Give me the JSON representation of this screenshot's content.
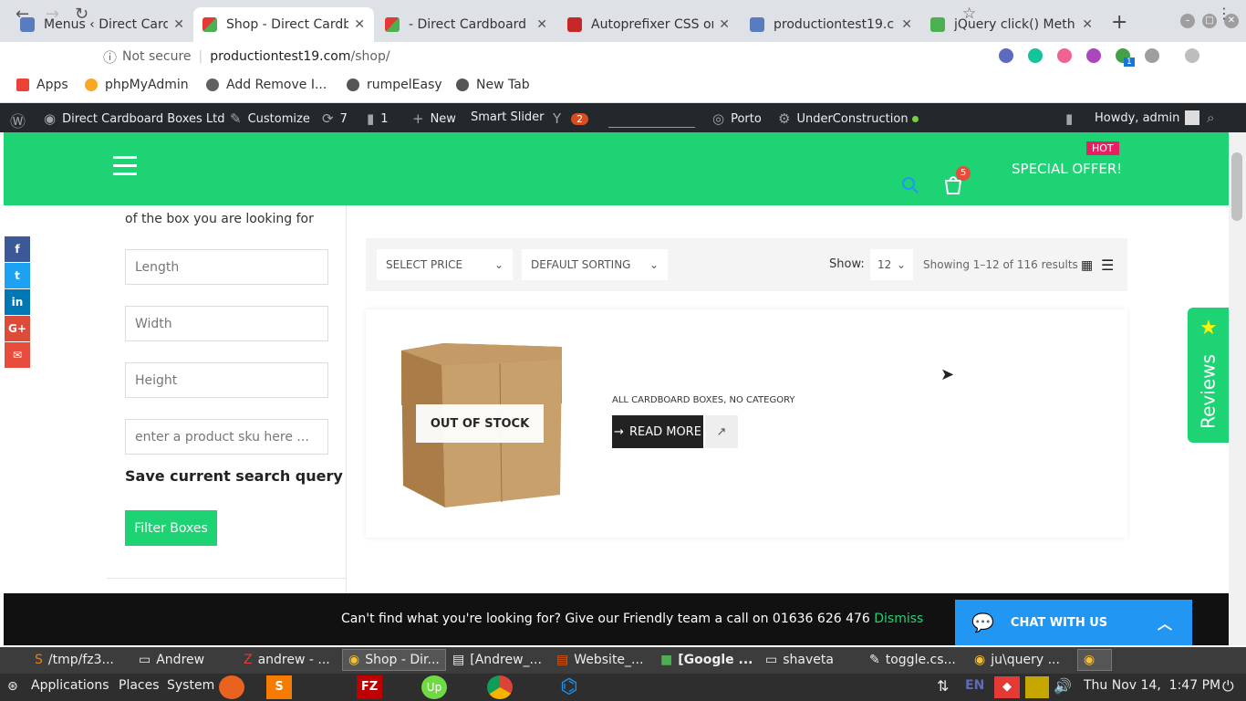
{
  "browser": {
    "tabs": [
      {
        "title": "Menus ‹ Direct Card",
        "icon": "wordpress-icon"
      },
      {
        "title": "Shop - Direct Cardbo",
        "icon": "cube-icon",
        "active": true
      },
      {
        "title": "- Direct Cardboard E",
        "icon": "cube-icon"
      },
      {
        "title": "Autoprefixer CSS on",
        "icon": "autoprefixer-icon"
      },
      {
        "title": "productiontest19.c",
        "icon": "wordpress-icon"
      },
      {
        "title": "jQuery click() Meth",
        "icon": "w3schools-icon"
      }
    ],
    "security": "Not secure",
    "url_host": "productiontest19.com",
    "url_path": "/shop/",
    "bookmarks": [
      "Apps",
      "phpMyAdmin",
      "Add Remove I...",
      "rumpelEasy",
      "New Tab"
    ],
    "ext_badge": "1"
  },
  "wp_admin_bar": {
    "site": "Direct Cardboard Boxes Ltd",
    "customize": "Customize",
    "updates": "7",
    "comments": "1",
    "new": "New",
    "smart_slider": "Smart Slider",
    "yoast_count": "2",
    "porto": "Porto",
    "under_construction": "UnderConstruction",
    "howdy": "Howdy, admin"
  },
  "header": {
    "hot": "HOT",
    "special_offer": "SPECIAL OFFER!",
    "cart_count": "5"
  },
  "sidebar": {
    "intro": "of the box you are looking for",
    "length_placeholder": "Length",
    "width_placeholder": "Width",
    "height_placeholder": "Height",
    "sku_placeholder": "enter a product sku here ...",
    "save_query": "Save current search query",
    "filter_button": "Filter Boxes"
  },
  "toolbar": {
    "select_price": "SELECT PRICE",
    "default_sorting": "DEFAULT SORTING",
    "show_label": "Show:",
    "show_value": "12",
    "results": "Showing 1–12 of 116 results"
  },
  "product": {
    "stock": "OUT OF STOCK",
    "categories": "ALL CARDBOARD BOXES, NO CATEGORY",
    "read_more": "READ MORE"
  },
  "reviews_tab": "Reviews",
  "notice": {
    "text": "Can't find what you're looking for? Give our Friendly team a call on 01636 626 476",
    "dismiss": "Dismiss"
  },
  "chat": "CHAT WITH US",
  "taskbar": {
    "windows": [
      "/tmp/fz3...",
      "Andrew",
      "andrew - ...",
      "Shop - Dir...",
      "[Andrew_...",
      "Website_...",
      "[Google ...",
      "shaveta",
      "toggle.cs...",
      "ju\\query ..."
    ],
    "menus": [
      "Applications",
      "Places",
      "System"
    ],
    "lang": "EN",
    "clock": "Thu Nov 14,  1:47 PM"
  },
  "colors": {
    "brand_green": "#1ed373",
    "chat_blue": "#2196f3",
    "admin_bar": "#23282d"
  }
}
